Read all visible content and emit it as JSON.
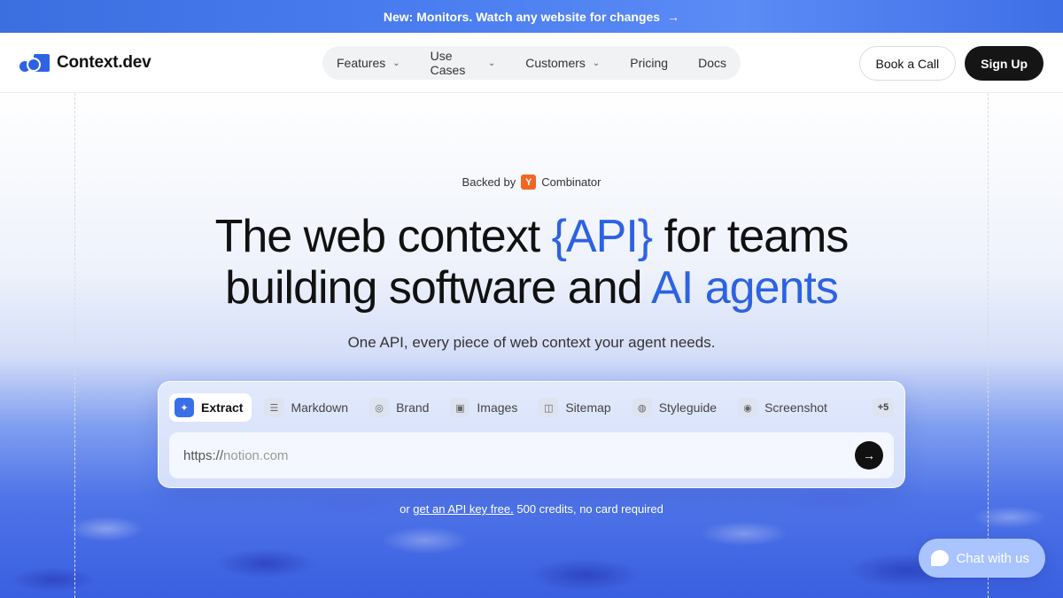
{
  "announcement": {
    "text": "New: Monitors. Watch any website for changes",
    "arrow": "→"
  },
  "header": {
    "logo_text": "Context.dev",
    "nav": [
      {
        "label": "Features",
        "has_dropdown": true
      },
      {
        "label": "Use Cases",
        "has_dropdown": true
      },
      {
        "label": "Customers",
        "has_dropdown": true
      },
      {
        "label": "Pricing",
        "has_dropdown": false
      },
      {
        "label": "Docs",
        "has_dropdown": false
      }
    ],
    "book_call_label": "Book a Call",
    "sign_up_label": "Sign Up"
  },
  "hero": {
    "backed_prefix": "Backed by",
    "yc_badge": "Y",
    "backed_name": "Combinator",
    "headline_part1": "The web context ",
    "headline_accent1": "{API}",
    "headline_part2": " for teams",
    "headline_part3": "building software and ",
    "headline_accent2": "AI agents",
    "subheading": "One API, every piece of web context your agent needs."
  },
  "api_card": {
    "tabs": [
      {
        "label": "Extract",
        "icon": "sparkle-icon",
        "active": true
      },
      {
        "label": "Markdown",
        "icon": "document-icon",
        "active": false
      },
      {
        "label": "Brand",
        "icon": "target-icon",
        "active": false
      },
      {
        "label": "Images",
        "icon": "image-icon",
        "active": false
      },
      {
        "label": "Sitemap",
        "icon": "map-icon",
        "active": false
      },
      {
        "label": "Styleguide",
        "icon": "palette-icon",
        "active": false
      },
      {
        "label": "Screenshot",
        "icon": "camera-icon",
        "active": false
      }
    ],
    "more_tabs_label": "+5",
    "url_prefix": "https://",
    "url_placeholder": "notion.com",
    "submit_icon": "arrow-right-icon"
  },
  "api_note": {
    "prefix": "or ",
    "link": "get an API key free.",
    "suffix": " 500 credits, no card required"
  },
  "chat": {
    "label": "Chat with us"
  },
  "colors": {
    "accent": "#2d63e3",
    "dark_button": "#151515",
    "yc_orange": "#f26522"
  }
}
